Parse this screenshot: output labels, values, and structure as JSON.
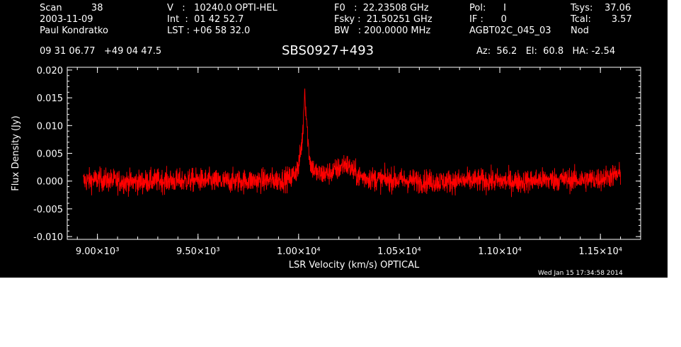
{
  "header": {
    "row1": {
      "scan": "Scan          38",
      "v": "V   :   10240.0 OPTI-HEL",
      "f0": "F0   :  22.23508 GHz",
      "pol": "Pol:      I",
      "tsys": "Tsys:    37.06"
    },
    "row2": {
      "date": "2003-11-09",
      "int": "Int  :  01 42 52.7",
      "fsky": "Fsky :  21.50251 GHz",
      "if": "IF :      0",
      "tcal": "Tcal:       3.57"
    },
    "row3": {
      "observer": "Paul Kondratko",
      "lst": "LST : +06 58 32.0",
      "bw": "BW   : 200.0000 MHz",
      "project": "AGBT02C_045_03",
      "mode": "Nod"
    },
    "coords": "09 31 06.77   +49 04 47.5",
    "source": "SBS0927+493",
    "azel": "Az:  56.2   El:  60.8   HA: -2.54",
    "timestamp": "Wed Jan 15 17:34:58 2014"
  },
  "colors": {
    "background": "#000000",
    "axes": "#ffffff",
    "trace": "#ff0000"
  },
  "chart_data": {
    "type": "line",
    "xlabel": "LSR Velocity (km/s) OPTICAL",
    "ylabel": "Flux Density (Jy)",
    "xlim": [
      8850,
      11700
    ],
    "ylim": [
      -0.0105,
      0.0205
    ],
    "x_ticks": [
      9000,
      9500,
      10000,
      10500,
      11000,
      11500
    ],
    "x_tick_labels": [
      "9.00×10³",
      "9.50×10³",
      "1.00×10⁴",
      "1.05×10⁴",
      "1.10×10⁴",
      "1.15×10⁴"
    ],
    "y_ticks": [
      -0.01,
      -0.005,
      0.0,
      0.005,
      0.01,
      0.015,
      0.02
    ],
    "y_tick_labels": [
      "-0.010",
      "-0.005",
      "0.000",
      "0.005",
      "0.010",
      "0.015",
      "0.020"
    ],
    "grid": false,
    "series": [
      {
        "color": "#ff0000",
        "x": [
          8930,
          9000,
          9100,
          9200,
          9300,
          9400,
          9500,
          9600,
          9700,
          9800,
          9900,
          9960,
          10000,
          10020,
          10030,
          10040,
          10050,
          10060,
          10080,
          10100,
          10150,
          10200,
          10230,
          10260,
          10300,
          10400,
          10500,
          10600,
          10700,
          10800,
          10900,
          11000,
          11100,
          11200,
          11300,
          11400,
          11500,
          11550,
          11600
        ],
        "y": [
          0.0,
          0.0003,
          0.0,
          -0.0002,
          0.0001,
          0.0,
          0.0002,
          -0.0001,
          0.0,
          0.0001,
          0.0002,
          0.0005,
          0.0025,
          0.008,
          0.0165,
          0.011,
          0.0055,
          0.003,
          0.0018,
          0.0012,
          0.0014,
          0.0022,
          0.0032,
          0.0022,
          0.0008,
          0.0003,
          0.0002,
          0.0,
          -0.0001,
          0.0,
          0.0001,
          0.0,
          -0.0001,
          0.0002,
          0.0003,
          0.0002,
          0.0004,
          0.0009,
          0.0012
        ]
      }
    ]
  }
}
